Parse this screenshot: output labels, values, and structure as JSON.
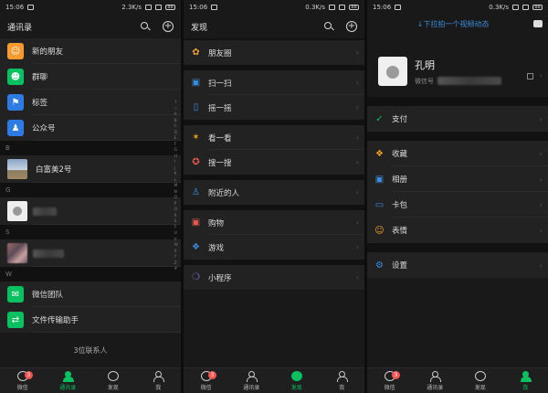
{
  "status": {
    "time": "15:06",
    "speeds": [
      "2.3K/s",
      "0.3K/s",
      "0.3K/s"
    ],
    "battery": "88"
  },
  "contacts": {
    "title": "通讯录",
    "items": [
      {
        "label": "新的朋友",
        "color": "#f79b2e",
        "icon": "add-friend-icon"
      },
      {
        "label": "群聊",
        "color": "#07c160",
        "icon": "group-icon"
      },
      {
        "label": "标签",
        "color": "#2f7be4",
        "icon": "tag-icon"
      },
      {
        "label": "公众号",
        "color": "#2f7be4",
        "icon": "official-account-icon"
      }
    ],
    "section_b": "B",
    "contact_b": "白富美2号",
    "section_g": "G",
    "section_s": "S",
    "section_w": "W",
    "services": [
      {
        "label": "微信团队",
        "color": "#07c160"
      },
      {
        "label": "文件传输助手",
        "color": "#07c160"
      }
    ],
    "count": "3位联系人",
    "alphabet": [
      "↑",
      "☆",
      "A",
      "B",
      "C",
      "D",
      "E",
      "F",
      "G",
      "H",
      "I",
      "J",
      "K",
      "L",
      "M",
      "N",
      "O",
      "P",
      "Q",
      "R",
      "S",
      "T",
      "U",
      "V",
      "W",
      "X",
      "Y",
      "Z",
      "#"
    ]
  },
  "discover": {
    "title": "发现",
    "items": [
      {
        "label": "朋友圈",
        "icon": "moments-icon",
        "color": "#e8a33a"
      },
      {
        "label": "扫一扫",
        "icon": "scan-icon",
        "color": "#3b8cdc"
      },
      {
        "label": "摇一摇",
        "icon": "shake-icon",
        "color": "#3b8cdc"
      },
      {
        "label": "看一看",
        "icon": "top-stories-icon",
        "color": "#f0a020"
      },
      {
        "label": "搜一搜",
        "icon": "search-icon",
        "color": "#e85a4f"
      },
      {
        "label": "附近的人",
        "icon": "nearby-icon",
        "color": "#3b8cdc"
      },
      {
        "label": "购物",
        "icon": "shopping-icon",
        "color": "#e85a4f"
      },
      {
        "label": "游戏",
        "icon": "games-icon",
        "color": "#3b8cdc"
      },
      {
        "label": "小程序",
        "icon": "mini-programs-icon",
        "color": "#7b6fd6"
      }
    ]
  },
  "me": {
    "pulldown": "↓下拉拍一个视频动态",
    "name": "孔明",
    "wechat_id_label": "微信号",
    "items": [
      {
        "label": "支付",
        "icon": "pay-icon",
        "color": "#07c160"
      },
      {
        "label": "收藏",
        "icon": "favorites-icon",
        "color": "#f0a020"
      },
      {
        "label": "相册",
        "icon": "album-icon",
        "color": "#3b8cdc"
      },
      {
        "label": "卡包",
        "icon": "cards-icon",
        "color": "#3b8cdc"
      },
      {
        "label": "表情",
        "icon": "stickers-icon",
        "color": "#f0a020"
      },
      {
        "label": "设置",
        "icon": "settings-icon",
        "color": "#3b8cdc"
      }
    ]
  },
  "tabs": {
    "labels": [
      "微信",
      "通讯录",
      "发现",
      "我"
    ],
    "badge": "3"
  }
}
